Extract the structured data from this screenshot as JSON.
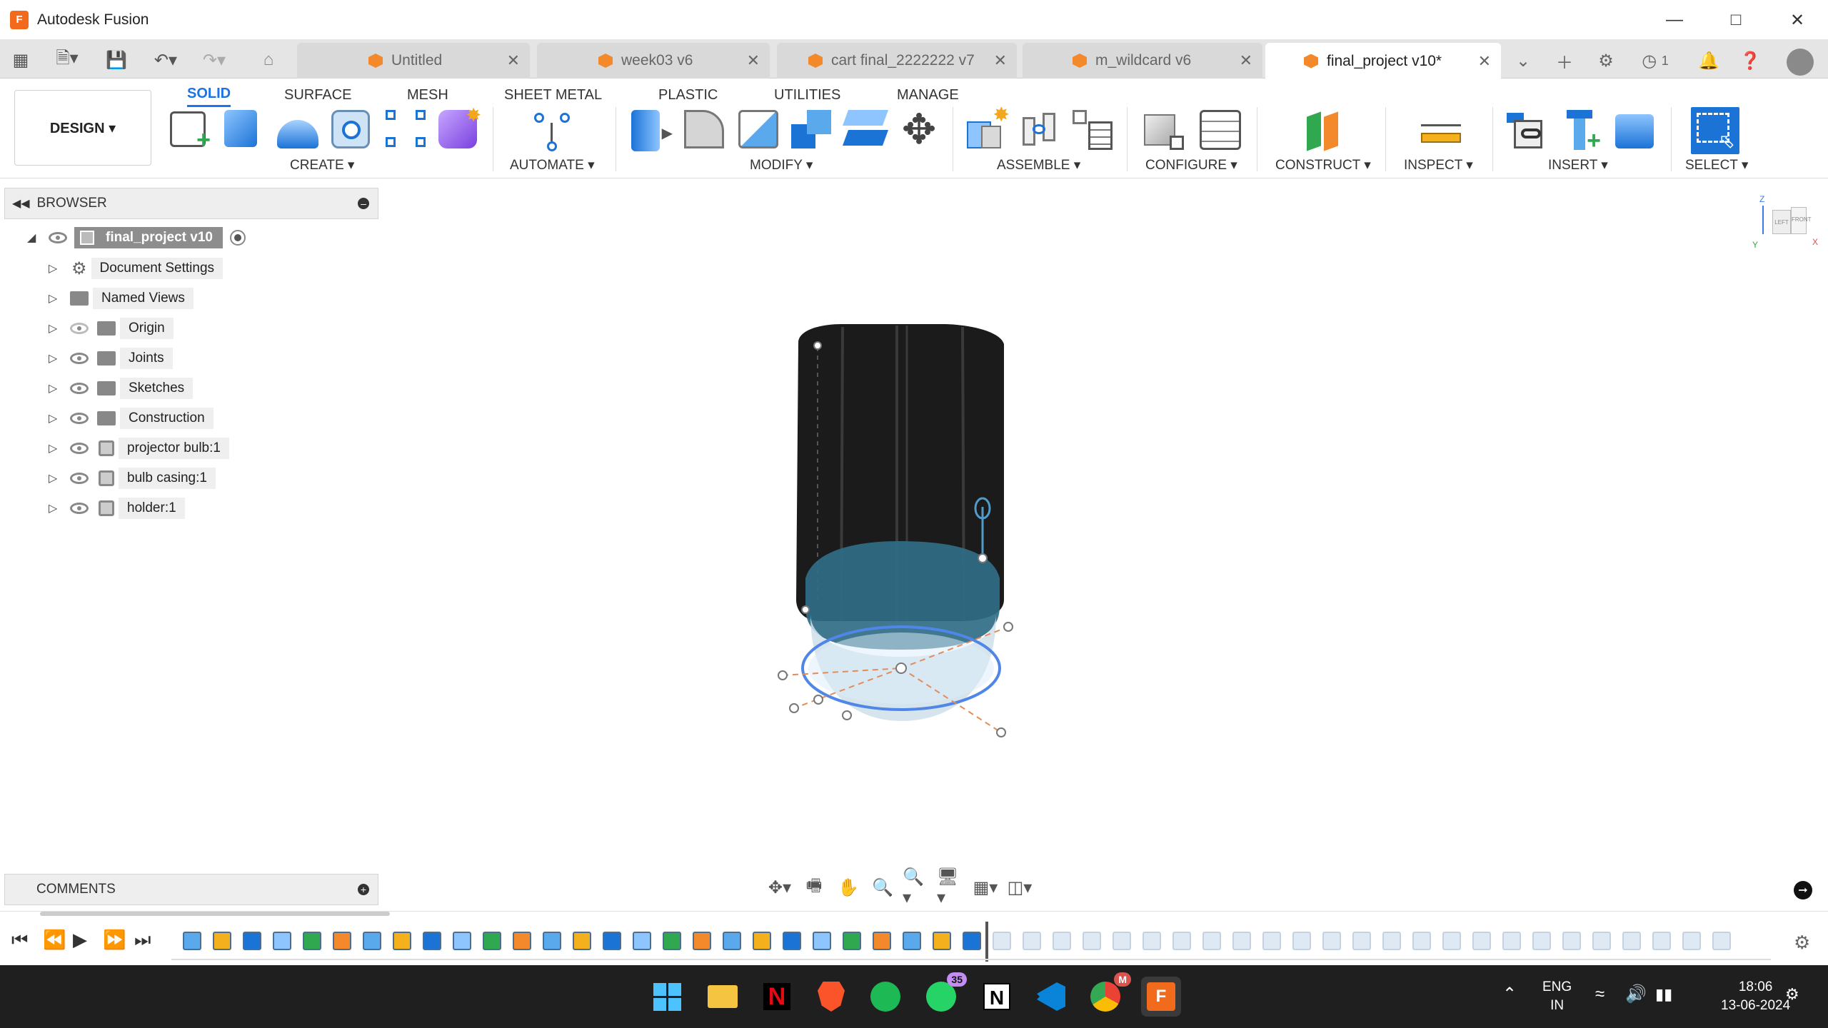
{
  "window": {
    "title": "Autodesk Fusion",
    "logo_letter": "F"
  },
  "tabs": [
    {
      "label": "Untitled",
      "active": false
    },
    {
      "label": "week03 v6",
      "active": false
    },
    {
      "label": "cart final_2222222 v7",
      "active": false
    },
    {
      "label": "m_wildcard v6",
      "active": false
    },
    {
      "label": "final_project v10*",
      "active": true
    }
  ],
  "job_status_count": "1",
  "ribbon": {
    "workspace": "DESIGN ▾",
    "tabs": [
      "SOLID",
      "SURFACE",
      "MESH",
      "SHEET METAL",
      "PLASTIC",
      "UTILITIES",
      "MANAGE"
    ],
    "groups": [
      "CREATE ▾",
      "AUTOMATE ▾",
      "MODIFY ▾",
      "ASSEMBLE ▾",
      "CONFIGURE ▾",
      "CONSTRUCT ▾",
      "INSPECT ▾",
      "INSERT ▾",
      "SELECT ▾"
    ]
  },
  "browser": {
    "title": "BROWSER",
    "root": "final_project v10",
    "items": [
      "Document Settings",
      "Named Views",
      "Origin",
      "Joints",
      "Sketches",
      "Construction",
      "projector bulb:1",
      "bulb casing:1",
      "holder:1"
    ]
  },
  "comments": {
    "title": "COMMENTS"
  },
  "viewcube": {
    "left": "LEFT",
    "front": "FRONT",
    "axis_x": "X",
    "axis_y": "Y",
    "axis_z": "Z"
  },
  "taskbar": {
    "whatsapp_badge": "35",
    "language": "ENG",
    "region": "IN",
    "time": "18:06",
    "date": "13-06-2024",
    "chrome_badge": "M"
  },
  "colors": {
    "accent": "#1a73e8",
    "fusion_orange": "#f26b1d",
    "model_dark": "#1b1b1b",
    "lens_blue": "#3f7f9a"
  }
}
